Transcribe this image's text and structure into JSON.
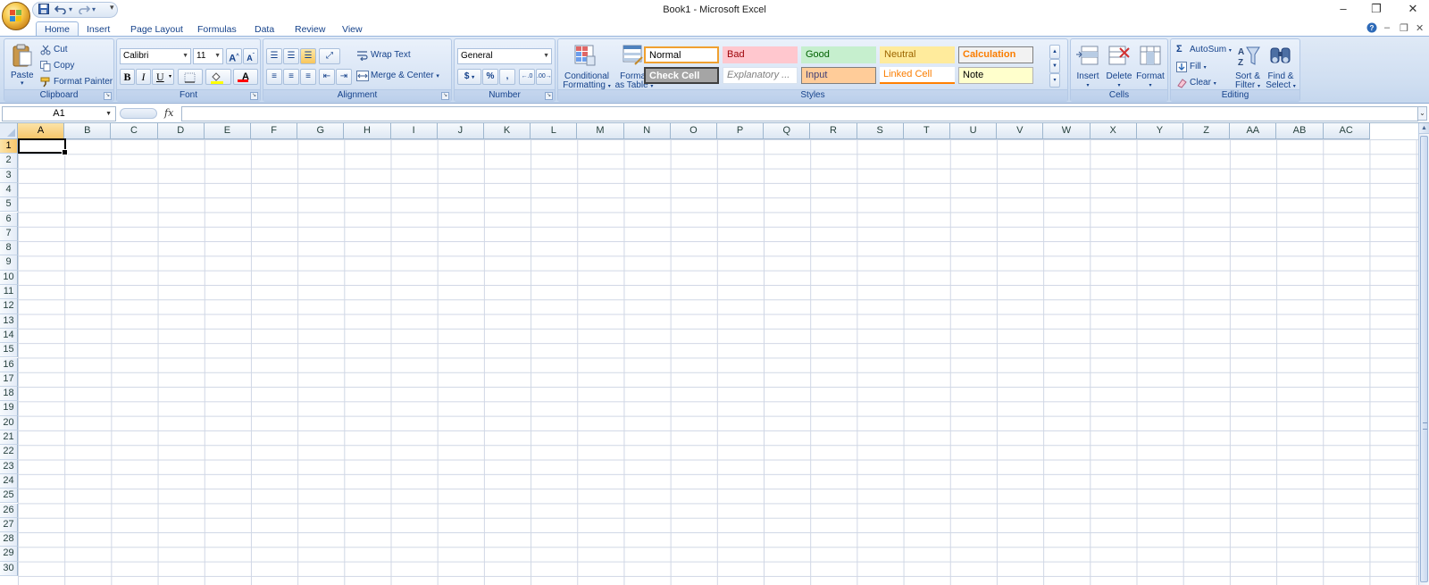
{
  "window": {
    "title": "Book1 - Microsoft Excel"
  },
  "qat_more": "▾",
  "tabs": [
    "Home",
    "Insert",
    "Page Layout",
    "Formulas",
    "Data",
    "Review",
    "View"
  ],
  "ribbon": {
    "clipboard": {
      "label": "Clipboard",
      "paste": "Paste",
      "cut": "Cut",
      "copy": "Copy",
      "format_painter": "Format Painter"
    },
    "font": {
      "label": "Font",
      "font_name": "Calibri",
      "font_size": "11",
      "grow": "A",
      "shrink": "A",
      "bold": "B",
      "italic": "I",
      "underline": "U",
      "font_color": "A"
    },
    "alignment": {
      "label": "Alignment",
      "wrap_text": "Wrap Text",
      "merge_center": "Merge & Center"
    },
    "number": {
      "label": "Number",
      "format": "General",
      "currency": "$",
      "percent": "%",
      "comma": ","
    },
    "styles": {
      "label": "Styles",
      "conditional_formatting": [
        "Conditional",
        "Formatting"
      ],
      "format_as_table": [
        "Format",
        "as Table"
      ],
      "cell_styles": [
        {
          "name": "Normal",
          "bg": "#ffffff",
          "color": "#000000",
          "border": "#f0a030"
        },
        {
          "name": "Bad",
          "bg": "#ffc7ce",
          "color": "#9c0006",
          "border": "#ffc7ce"
        },
        {
          "name": "Good",
          "bg": "#c6efce",
          "color": "#006100",
          "border": "#c6efce"
        },
        {
          "name": "Neutral",
          "bg": "#ffeb9c",
          "color": "#9c6500",
          "border": "#ffeb9c"
        },
        {
          "name": "Calculation",
          "bg": "#f2f2f2",
          "color": "#fa7d00",
          "border": "#7f7f7f"
        },
        {
          "name": "Check Cell",
          "bg": "#a5a5a5",
          "color": "#ffffff",
          "border": "#3f3f3f"
        },
        {
          "name": "Explanatory ...",
          "bg": "#ffffff",
          "color": "#7f7f7f",
          "border": "#d8e2ee"
        },
        {
          "name": "Input",
          "bg": "#ffcc99",
          "color": "#3f3f76",
          "border": "#7f7f7f"
        },
        {
          "name": "Linked Cell",
          "bg": "#ffffff",
          "color": "#fa7d00",
          "border": "#ff8001"
        },
        {
          "name": "Note",
          "bg": "#ffffcc",
          "color": "#000000",
          "border": "#b2b2b2"
        }
      ]
    },
    "cells": {
      "label": "Cells",
      "insert": "Insert",
      "delete": "Delete",
      "format": "Format"
    },
    "editing": {
      "label": "Editing",
      "autosum": "AutoSum",
      "fill": "Fill",
      "clear": "Clear",
      "sort_filter": [
        "Sort &",
        "Filter"
      ],
      "find_select": [
        "Find &",
        "Select"
      ]
    }
  },
  "formula_bar": {
    "name_box": "A1",
    "fx": "fx",
    "value": ""
  },
  "sheet": {
    "columns": [
      "A",
      "B",
      "C",
      "D",
      "E",
      "F",
      "G",
      "H",
      "I",
      "J",
      "K",
      "L",
      "M",
      "N",
      "O",
      "P",
      "Q",
      "R",
      "S",
      "T",
      "U",
      "V",
      "W",
      "X",
      "Y",
      "Z",
      "AA",
      "AB",
      "AC"
    ],
    "rows": [
      "1",
      "2",
      "3",
      "4",
      "5",
      "6",
      "7",
      "8",
      "9",
      "10",
      "11",
      "12",
      "13",
      "14",
      "15",
      "16",
      "17",
      "18",
      "19",
      "20",
      "21",
      "22",
      "23",
      "24",
      "25",
      "26",
      "27",
      "28",
      "29",
      "30"
    ],
    "active_cell": "A1"
  }
}
